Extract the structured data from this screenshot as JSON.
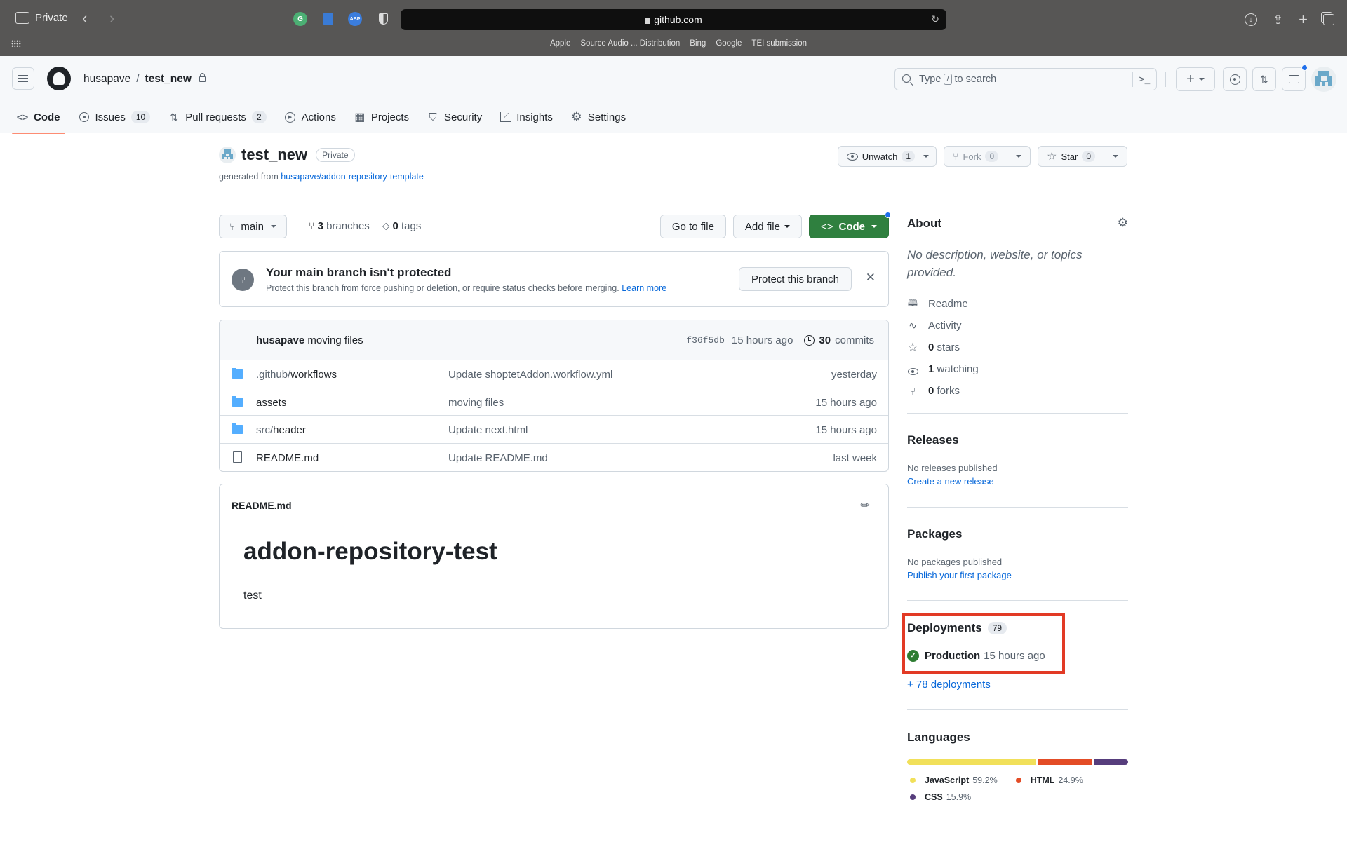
{
  "browser": {
    "mode_label": "Private",
    "url": "github.com",
    "extensions": [
      {
        "name": "grammarly",
        "glyph": "G",
        "color": "#4caf74"
      },
      {
        "name": "docs",
        "glyph": "",
        "color": "#3a7bd5"
      },
      {
        "name": "adblock-plus",
        "glyph": "ABP",
        "color": "#3b7ddd"
      },
      {
        "name": "privacy-shield",
        "glyph": "",
        "color": "#dddddd"
      }
    ],
    "bookmarks": [
      "Apple",
      "Source Audio ... Distribution",
      "Bing",
      "Google",
      "TEI submission"
    ]
  },
  "header": {
    "owner": "husapave",
    "separator": "/",
    "repo": "test_new",
    "search_prefix": "Type",
    "search_key": "/",
    "search_suffix": "to search",
    "command_palette_glyph": ">_",
    "new_glyph": "+"
  },
  "tabs": [
    {
      "label": "Code",
      "icon": "code-icon",
      "glyph": "<>",
      "active": true
    },
    {
      "label": "Issues",
      "icon": "issue-icon",
      "counter": "10"
    },
    {
      "label": "Pull requests",
      "icon": "pull-request-icon",
      "glyph": "⇅",
      "counter": "2"
    },
    {
      "label": "Actions",
      "icon": "play-icon",
      "glyph": "▶"
    },
    {
      "label": "Projects",
      "icon": "table-icon",
      "glyph": "▦"
    },
    {
      "label": "Security",
      "icon": "shield-icon",
      "glyph": "⛉"
    },
    {
      "label": "Insights",
      "icon": "graph-icon",
      "glyph": "⟋"
    },
    {
      "label": "Settings",
      "icon": "gear-icon",
      "glyph": "⚙"
    }
  ],
  "repo": {
    "name": "test_new",
    "visibility": "Private",
    "generated_prefix": "generated from",
    "template": "husapave/addon-repository-template",
    "watch": {
      "label": "Unwatch",
      "count": "1"
    },
    "fork": {
      "label": "Fork",
      "count": "0"
    },
    "star": {
      "label": "Star",
      "count": "0"
    }
  },
  "branch_bar": {
    "branch": "main",
    "branches_count": "3",
    "branches_label": "branches",
    "tags_count": "0",
    "tags_label": "tags",
    "go_to_file": "Go to file",
    "add_file": "Add file",
    "code": "Code"
  },
  "protect_banner": {
    "title": "Your main branch isn't protected",
    "description": "Protect this branch from force pushing or deletion, or require status checks before merging.",
    "learn_more": "Learn more",
    "button": "Protect this branch",
    "close_glyph": "✕"
  },
  "latest_commit": {
    "author": "husapave",
    "message": "moving files",
    "sha": "f36f5db",
    "age": "15 hours ago",
    "commits_count": "30",
    "commits_label": "commits"
  },
  "files": [
    {
      "type": "folder",
      "prefix": ".github/",
      "name": "workflows",
      "message": "Update shoptetAddon.workflow.yml",
      "age": "yesterday"
    },
    {
      "type": "folder",
      "prefix": "",
      "name": "assets",
      "message": "moving files",
      "age": "15 hours ago"
    },
    {
      "type": "folder",
      "prefix": "src/",
      "name": "header",
      "message": "Update next.html",
      "age": "15 hours ago"
    },
    {
      "type": "file",
      "prefix": "",
      "name": "README.md",
      "message": "Update README.md",
      "age": "last week"
    }
  ],
  "readme": {
    "filename": "README.md",
    "heading": "addon-repository-test",
    "body": "test"
  },
  "sidebar": {
    "about": {
      "title": "About",
      "description": "No description, website, or topics provided.",
      "items": [
        {
          "icon": "book-icon",
          "glyph": "📖",
          "bold": "",
          "label": "Readme"
        },
        {
          "icon": "pulse-icon",
          "glyph": "〰",
          "bold": "",
          "label": "Activity"
        },
        {
          "icon": "star-icon",
          "glyph": "☆",
          "bold": "0",
          "label": "stars"
        },
        {
          "icon": "eye-icon",
          "glyph": "◉",
          "bold": "1",
          "label": "watching"
        },
        {
          "icon": "fork-icon",
          "glyph": "⑂",
          "bold": "0",
          "label": "forks"
        }
      ]
    },
    "releases": {
      "title": "Releases",
      "empty": "No releases published",
      "link": "Create a new release"
    },
    "packages": {
      "title": "Packages",
      "empty": "No packages published",
      "link": "Publish your first package"
    },
    "deployments": {
      "title": "Deployments",
      "count": "79",
      "env": "Production",
      "age": "15 hours ago",
      "more": "+ 78 deployments",
      "highlight_color": "#e23a25"
    },
    "languages": {
      "title": "Languages",
      "items": [
        {
          "name": "JavaScript",
          "percent": 59.2,
          "percent_label": "59.2%",
          "color": "#f1e05a"
        },
        {
          "name": "HTML",
          "percent": 24.9,
          "percent_label": "24.9%",
          "color": "#e34c26"
        },
        {
          "name": "CSS",
          "percent": 15.9,
          "percent_label": "15.9%",
          "color": "#563d7c"
        }
      ]
    }
  }
}
